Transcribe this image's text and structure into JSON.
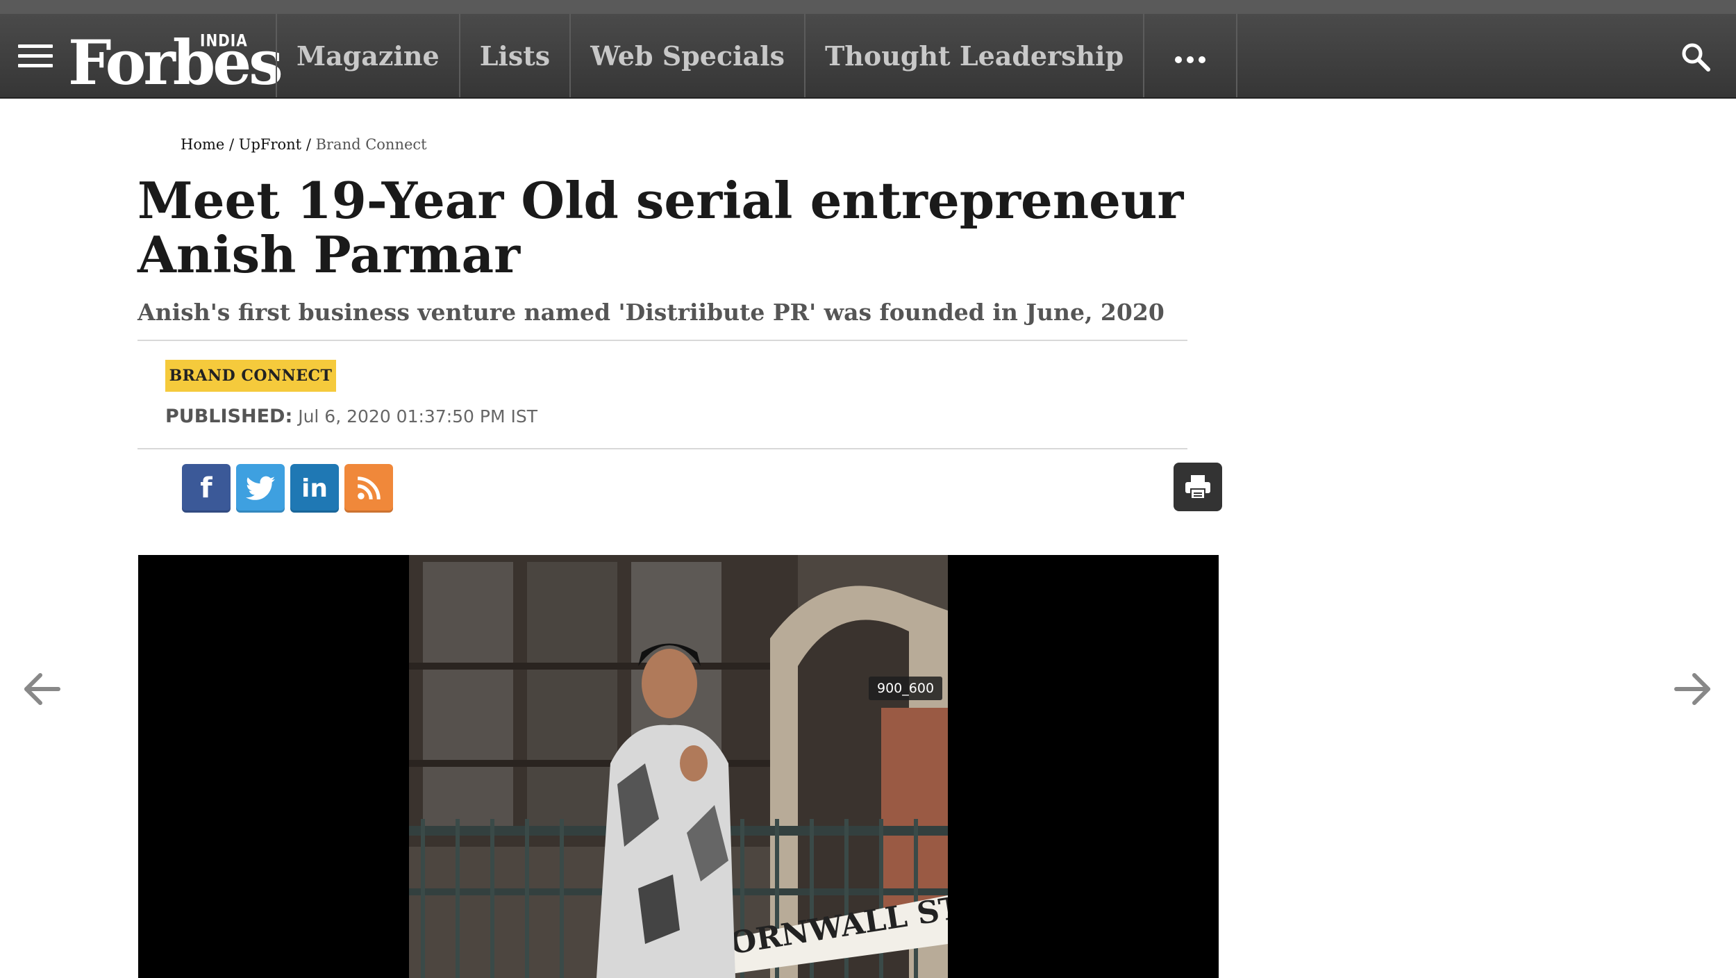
{
  "nav": {
    "brand": "Forbes",
    "edition": "INDIA",
    "links": [
      "Magazine",
      "Lists",
      "Web Specials",
      "Thought Leadership"
    ]
  },
  "breadcrumb": {
    "home": "Home",
    "section": "UpFront",
    "current": "Brand Connect"
  },
  "article": {
    "title": "Meet 19-Year Old serial entrepreneur Anish Parmar",
    "subtitle": "Anish's first business venture named 'Distriibute PR' was founded in June, 2020",
    "badge": "BRAND CONNECT",
    "published_label": "PUBLISHED:",
    "published_value": " Jul 6, 2020 01:37:50 PM IST",
    "image_label": "900_600",
    "sign_text": "CORNWALL ST"
  },
  "social": {
    "facebook": "f",
    "linkedin": "in"
  },
  "colors": {
    "nav_bg": "#3f3f3f",
    "badge": "#f5ca3c",
    "facebook": "#3b5998",
    "twitter": "#3ea0e0",
    "linkedin": "#1f78b4",
    "rss": "#f0883a"
  },
  "icons": [
    "menu-icon",
    "search-icon",
    "more-icon",
    "print-icon",
    "arrow-left-icon",
    "arrow-right-icon"
  ]
}
